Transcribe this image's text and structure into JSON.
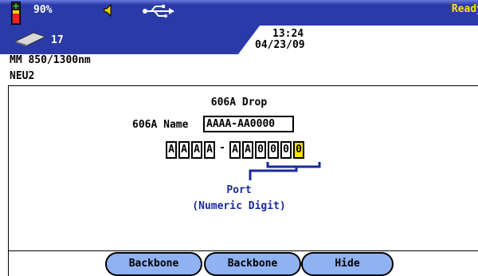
{
  "status": {
    "battery_percent": "90%",
    "speaker_icon": "speaker-icon",
    "usb_icon": "usb-icon",
    "state": "Ready",
    "storage_count": "17",
    "time": "13:24",
    "date": "04/23/09"
  },
  "info": {
    "fiber": "MM 850/1300nm",
    "tag": "NEU2"
  },
  "main": {
    "title": "606A Drop",
    "name_label": "606A Name",
    "name_value": "AAAA-AA0000",
    "chars": [
      "A",
      "A",
      "A",
      "A",
      "-",
      "A",
      "A",
      "0",
      "0",
      "0",
      "0"
    ],
    "selected_index": 10,
    "port_label": "Port",
    "port_hint": "(Numeric Digit)"
  },
  "softkeys": {
    "key1": "Backbone",
    "key2": "Backbone",
    "key3": "Hide"
  },
  "colors": {
    "header": "#2a3aa8",
    "highlight": "#ffe500",
    "softkey": "#8fb2f2",
    "port_text": "#1a2a9c"
  }
}
